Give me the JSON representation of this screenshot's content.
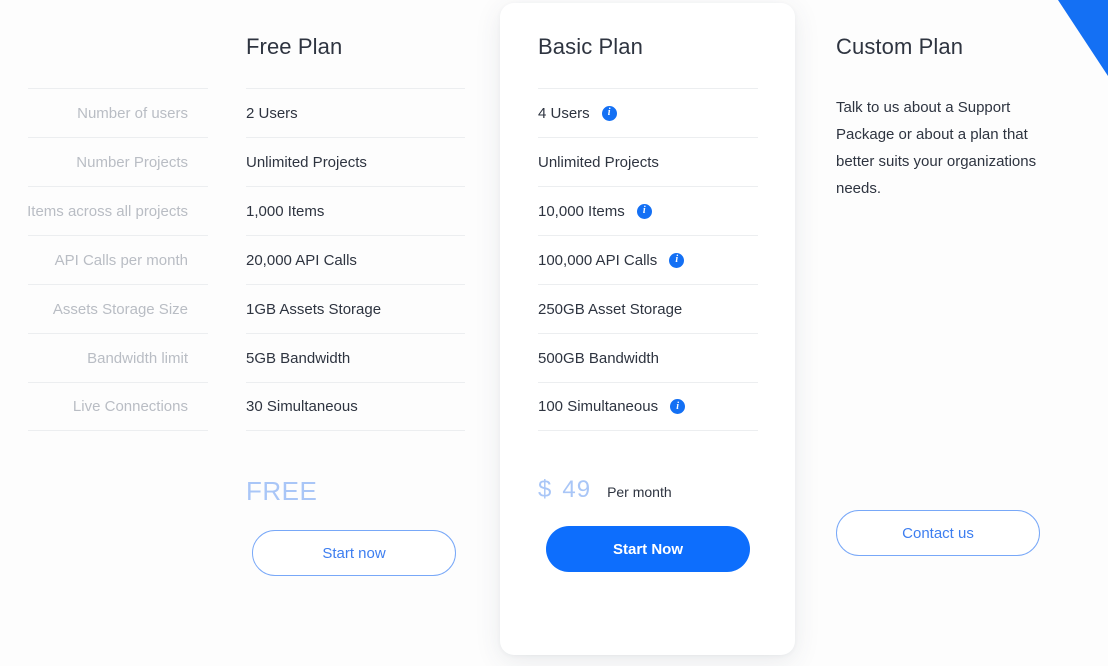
{
  "theme": {
    "accent_blue": "#0d6efd",
    "light_blue": "#a9c6f7",
    "outline_blue": "#78a8f8",
    "label_gray": "#b9bdc4",
    "text_dark": "#2e3440",
    "divider": "#eceef0",
    "page_bg": "#fdfdfd"
  },
  "features": [
    "Number of users",
    "Number Projects",
    "Items across all projects",
    "API Calls per month",
    "Assets Storage Size",
    "Bandwidth limit",
    "Live Connections"
  ],
  "plans": {
    "free": {
      "title": "Free Plan",
      "values": [
        {
          "text": "2 Users",
          "info": false
        },
        {
          "text": "Unlimited Projects",
          "info": false
        },
        {
          "text": "1,000 Items",
          "info": false
        },
        {
          "text": "20,000 API Calls",
          "info": false
        },
        {
          "text": "1GB Assets Storage",
          "info": false
        },
        {
          "text": "5GB Bandwidth",
          "info": false
        },
        {
          "text": "30 Simultaneous",
          "info": false
        }
      ],
      "price": "FREE",
      "cta": "Start now"
    },
    "basic": {
      "title": "Basic Plan",
      "values": [
        {
          "text": "4 Users",
          "info": true
        },
        {
          "text": "Unlimited Projects",
          "info": false
        },
        {
          "text": "10,000 Items",
          "info": true
        },
        {
          "text": "100,000 API Calls",
          "info": true
        },
        {
          "text": "250GB Asset Storage",
          "info": false
        },
        {
          "text": "500GB Bandwidth",
          "info": false
        },
        {
          "text": "100 Simultaneous",
          "info": true
        }
      ],
      "price_currency": "$",
      "price_amount": "49",
      "price_period": "Per month",
      "cta": "Start Now"
    },
    "custom": {
      "title": "Custom Plan",
      "description": "Talk to us about a Support Package or about a plan that better suits your organizations needs.",
      "cta": "Contact us"
    }
  },
  "info_icon_glyph": "i"
}
